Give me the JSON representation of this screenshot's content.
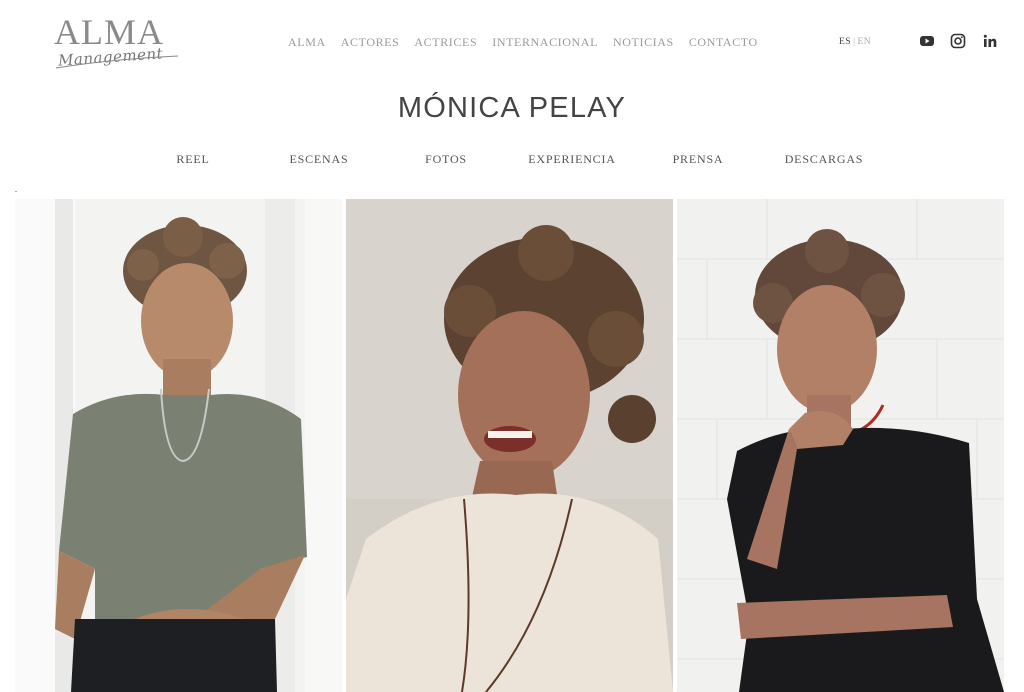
{
  "brand": {
    "name": "ALMA",
    "tagline": "Management"
  },
  "nav": {
    "items": [
      "ALMA",
      "ACTORES",
      "ACTRICES",
      "INTERNACIONAL",
      "NOTICIAS",
      "CONTACTO"
    ]
  },
  "language": {
    "active": "ES",
    "separator": "|",
    "other": "EN"
  },
  "social": [
    "youtube-icon",
    "instagram-icon",
    "linkedin-icon"
  ],
  "title": "MÓNICA PELAY",
  "subnav": [
    "REEL",
    "ESCENAS",
    "FOTOS",
    "EXPERIENCIA",
    "PRENSA",
    "DESCARGAS"
  ],
  "gallery": {
    "photos": [
      {
        "top": "green t-shirt",
        "background": "white curtain"
      },
      {
        "top": "beige linen blouse",
        "background": "beige wall"
      },
      {
        "top": "black long-sleeve",
        "background": "white brick wall"
      }
    ]
  },
  "colors": {
    "text": "#555555",
    "nav_light": "#9a9a9a",
    "background": "#ffffff"
  }
}
